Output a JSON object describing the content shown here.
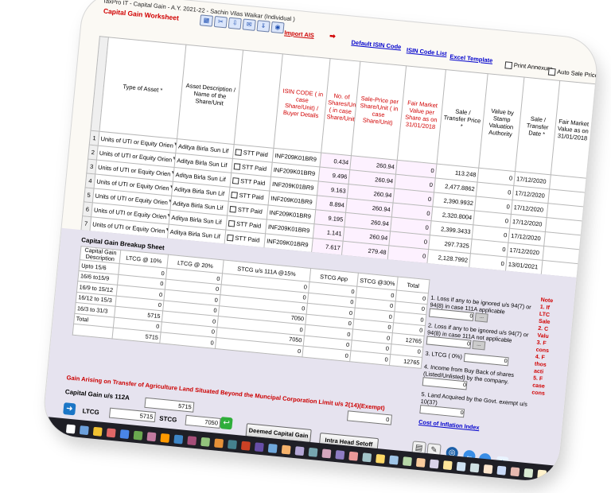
{
  "window": {
    "title": "TaxPro IT - Capital Gain - A.Y. 2021-22 - Sachin Vilas Waikar (Individual )"
  },
  "worksheet_title": "Capital Gain Worksheet",
  "toolbar": {
    "icons": [
      "excel-icon",
      "cut-icon",
      "import-icon",
      "email-icon",
      "down-icon",
      "web-icon"
    ]
  },
  "links": {
    "import_ais": "Import AIS",
    "default_isin": "Default ISIN Code",
    "isin_list": "ISIN Code List",
    "excel_template": "Excel Template"
  },
  "checks": {
    "print_annexure": "Print Annexure",
    "auto_sale_price": "Auto Sale Price"
  },
  "grid": {
    "headers": [
      "Type of Asset *",
      "Asset Description / Name of the Share/Unit",
      "",
      "ISIN CODE ( in case Share/Unit) / Buyer Details",
      "No. of Shares/Units ( in case Share/Unit)",
      "Sale-Price per Share/Unit ( in case Share/Unit)",
      "Fair Market Value per Share as on 31/01/2018",
      "Sale / Transfer Price *",
      "Value by Stamp Valuation Authority",
      "Sale / Transfer Date *",
      "Fair Market Value as on 31/01/2018"
    ],
    "rows": [
      {
        "no": "1",
        "type": "Units of UTI or Equity Orien",
        "desc": "Aditya Birla Sun Lif",
        "stt": "STT Paid",
        "isin": "INF209K01BR9",
        "shares": "0.434",
        "sale_per": "260.94",
        "fmv": "0",
        "price": "113.248",
        "stamp": "0",
        "date": "17/12/2020"
      },
      {
        "no": "2",
        "type": "Units of UTI or Equity Orien",
        "desc": "Aditya Birla Sun Lif",
        "stt": "STT Paid",
        "isin": "INF209K01BR9",
        "shares": "9.496",
        "sale_per": "260.94",
        "fmv": "0",
        "price": "2,477.8862",
        "stamp": "0",
        "date": "17/12/2020"
      },
      {
        "no": "3",
        "type": "Units of UTI or Equity Orien",
        "desc": "Aditya Birla Sun Lif",
        "stt": "STT Paid",
        "isin": "INF209K01BR9",
        "shares": "9.163",
        "sale_per": "260.94",
        "fmv": "0",
        "price": "2,390.9932",
        "stamp": "0",
        "date": "17/12/2020"
      },
      {
        "no": "4",
        "type": "Units of UTI or Equity Orien",
        "desc": "Aditya Birla Sun Lif",
        "stt": "STT Paid",
        "isin": "INF209K01BR9",
        "shares": "8.894",
        "sale_per": "260.94",
        "fmv": "0",
        "price": "2,320.8004",
        "stamp": "0",
        "date": "17/12/2020"
      },
      {
        "no": "5",
        "type": "Units of UTI or Equity Orien",
        "desc": "Aditya Birla Sun Lif",
        "stt": "STT Paid",
        "isin": "INF209K01BR9",
        "shares": "9.195",
        "sale_per": "260.94",
        "fmv": "0",
        "price": "2,399.3433",
        "stamp": "0",
        "date": "17/12/2020"
      },
      {
        "no": "6",
        "type": "Units of UTI or Equity Orien",
        "desc": "Aditya Birla Sun Lif",
        "stt": "STT Paid",
        "isin": "INF209K01BR9",
        "shares": "1.141",
        "sale_per": "260.94",
        "fmv": "0",
        "price": "297.7325",
        "stamp": "0",
        "date": "17/12/2020"
      },
      {
        "no": "7",
        "type": "Units of UTI or Equity Orien",
        "desc": "Aditya Birla Sun Lif",
        "stt": "STT Paid",
        "isin": "INF209K01BR9",
        "shares": "7.617",
        "sale_per": "279.48",
        "fmv": "0",
        "price": "2,128.7992",
        "stamp": "0",
        "date": "13/01/2021"
      }
    ]
  },
  "breakup": {
    "title": "Capital Gain Breakup Sheet",
    "headers": [
      "Capital Gain Description",
      "LTCG @ 10%",
      "LTCG @ 20%",
      "STCG u/s 111A @15%",
      "STCG App",
      "STCG @30%",
      "Total"
    ],
    "rows": [
      [
        "Upto 15/6",
        "0",
        "0",
        "0",
        "0",
        "0",
        "0"
      ],
      [
        "16/6 to15/9",
        "0",
        "0",
        "0",
        "0",
        "0",
        "0"
      ],
      [
        "16/9 to 15/12",
        "0",
        "0",
        "0",
        "0",
        "0",
        "0"
      ],
      [
        "16/12 to 15/3",
        "0",
        "0",
        "7050",
        "0",
        "0",
        "0"
      ],
      [
        "16/3 to 31/3",
        "5715",
        "0",
        "0",
        "0",
        "0",
        "12765"
      ],
      [
        "Total",
        "0",
        "0",
        "7050",
        "0",
        "0",
        "0"
      ],
      [
        "",
        "5715",
        "0",
        "0",
        "0",
        "0",
        "12765"
      ]
    ]
  },
  "right_panel": {
    "item1": "1. Loss if any to be ignored u/s 94(7) or 94(8) in case 111A applicable",
    "item1_val": "0",
    "item2": "2. Loss if any to be ignored u/s 94(7) or 94(8) in case 111A not applicable",
    "item2_val": "0",
    "item3": "3. LTCG ( 0%)",
    "item3_val": "0",
    "item4": "4. Income from Buy Back of shares (Listed/Unlisted) by the company.",
    "item4_val": "0",
    "item5": "5. Land Acquired by the Govt. exempt u/s 10(37)",
    "item5_val": "0",
    "cost_link": "Cost of Inflation Index"
  },
  "notes": [
    "Note",
    "1. If",
    "LTC",
    "Sale",
    "2. C",
    "Valu",
    "3. F",
    "cons",
    "4. F",
    "thos",
    "acti",
    "5. F",
    "case",
    "cons"
  ],
  "agri": {
    "label": "Gain Arising on Transfer of Agriculture Land Situated Beyond the Muncipal Corporation Limit  u/s 2(14)(Exempt)",
    "value": "0"
  },
  "cg112a": {
    "label": "Capital Gain u/s 112A",
    "value": "5715",
    "ltcg_label": "LTCG",
    "ltcg": "5715",
    "stcg_label": "STCG",
    "stcg": "7050"
  },
  "buttons": {
    "deemed": "Deemed Capital Gain",
    "intra": "Intra Head Setoff"
  },
  "colors": {
    "title_red": "#d10000",
    "link_blue": "#0000cc",
    "section_bg": "#e6e3ef",
    "taskbar": "#1f1f26"
  }
}
